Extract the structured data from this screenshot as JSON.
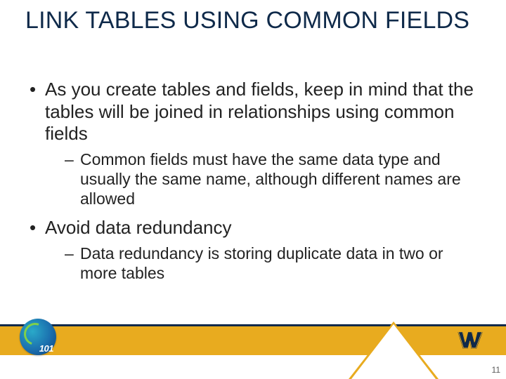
{
  "slide": {
    "title": "LINK TABLES USING COMMON FIELDS",
    "bullets": [
      {
        "text": "As you create tables and fields, keep in mind that the tables will be joined in relationships using common fields",
        "sub": [
          "Common fields must have the same data type and usually the same name, although different names are allowed"
        ]
      },
      {
        "text": "Avoid data redundancy",
        "sub": [
          "Data redundancy is storing duplicate data in two or more tables"
        ]
      }
    ],
    "footer": {
      "logo101_text": "101",
      "page_number": "11"
    }
  }
}
